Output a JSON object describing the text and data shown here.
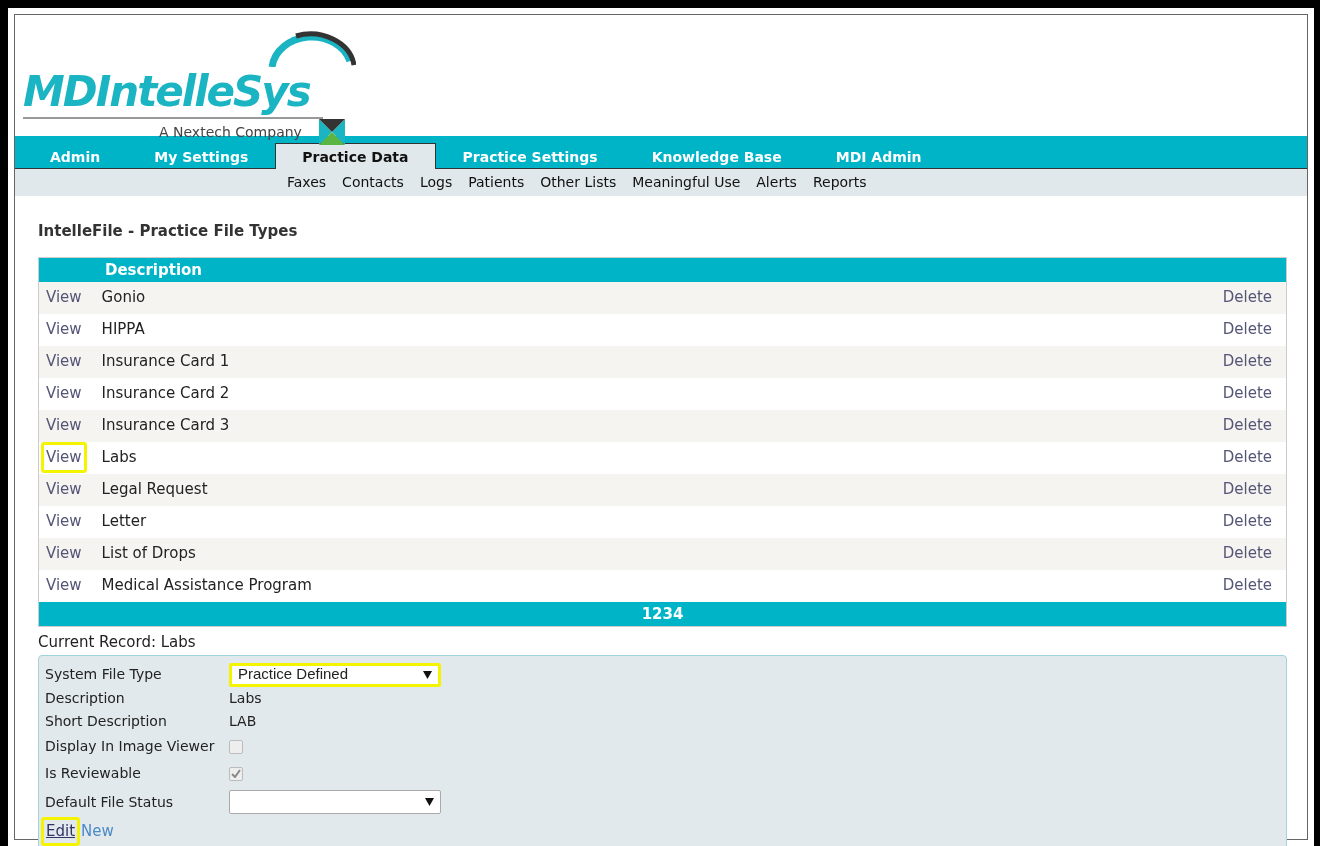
{
  "logo": {
    "name": "MDIntelleSys",
    "tagline": "A Nextech Company"
  },
  "tabs": [
    {
      "label": "Admin",
      "selected": false
    },
    {
      "label": "My Settings",
      "selected": false
    },
    {
      "label": "Practice Data",
      "selected": true
    },
    {
      "label": "Practice Settings",
      "selected": false
    },
    {
      "label": "Knowledge Base",
      "selected": false
    },
    {
      "label": "MDI Admin",
      "selected": false
    }
  ],
  "subnav": [
    "Faxes",
    "Contacts",
    "Logs",
    "Patients",
    "Other Lists",
    "Meaningful Use",
    "Alerts",
    "Reports"
  ],
  "page_title": "IntelleFile - Practice File Types",
  "table": {
    "columns": [
      "Description"
    ],
    "rows": [
      {
        "view": "View",
        "description": "Gonio",
        "delete": "Delete",
        "highlighted": false
      },
      {
        "view": "View",
        "description": "HIPPA",
        "delete": "Delete",
        "highlighted": false
      },
      {
        "view": "View",
        "description": "Insurance Card 1",
        "delete": "Delete",
        "highlighted": false
      },
      {
        "view": "View",
        "description": "Insurance Card 2",
        "delete": "Delete",
        "highlighted": false
      },
      {
        "view": "View",
        "description": "Insurance Card 3",
        "delete": "Delete",
        "highlighted": false
      },
      {
        "view": "View",
        "description": "Labs",
        "delete": "Delete",
        "highlighted": true
      },
      {
        "view": "View",
        "description": "Legal Request",
        "delete": "Delete",
        "highlighted": false
      },
      {
        "view": "View",
        "description": "Letter",
        "delete": "Delete",
        "highlighted": false
      },
      {
        "view": "View",
        "description": "List of Drops",
        "delete": "Delete",
        "highlighted": false
      },
      {
        "view": "View",
        "description": "Medical Assistance Program",
        "delete": "Delete",
        "highlighted": false
      }
    ],
    "pager": "1234"
  },
  "current_record": "Current Record: Labs",
  "form": {
    "fields": [
      {
        "kind": "select",
        "label": "System File Type",
        "value": "Practice Defined",
        "highlighted": true
      },
      {
        "kind": "text",
        "label": "Description",
        "value": "Labs"
      },
      {
        "kind": "text",
        "label": "Short Description",
        "value": "LAB"
      },
      {
        "kind": "checkbox",
        "label": "Display In Image Viewer",
        "checked": false
      },
      {
        "kind": "checkbox",
        "label": "Is Reviewable",
        "checked": true
      },
      {
        "kind": "select",
        "label": "Default File Status",
        "highlighted": false
      }
    ],
    "actions": [
      {
        "label": "Edit",
        "highlighted": true
      },
      {
        "label": "New",
        "highlighted": false
      }
    ]
  }
}
